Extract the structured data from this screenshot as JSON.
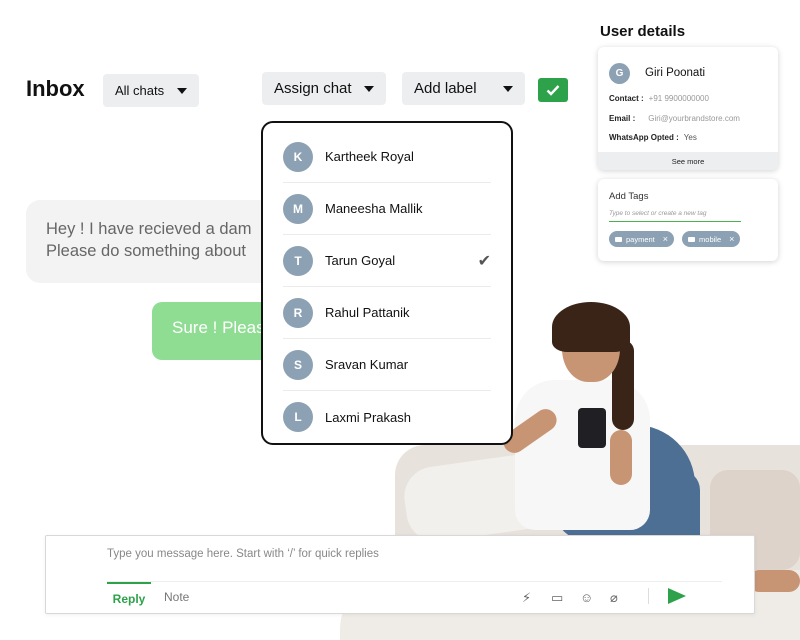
{
  "header": {
    "title": "Inbox",
    "filter_label": "All chats",
    "assign_label": "Assign chat",
    "label_label": "Add label",
    "confirm_icon": "check-icon",
    "accent_color": "#2ea24a"
  },
  "messages": {
    "incoming": [
      "Hey ! I have recieved a dam",
      "Please do something about"
    ],
    "outgoing": "Sure ! Pleas"
  },
  "assign_menu": {
    "agents": [
      {
        "initial": "K",
        "name": "Kartheek Royal",
        "selected": false
      },
      {
        "initial": "M",
        "name": "Maneesha Mallik",
        "selected": false
      },
      {
        "initial": "T",
        "name": "Tarun Goyal",
        "selected": true
      },
      {
        "initial": "R",
        "name": "Rahul Pattanik",
        "selected": false
      },
      {
        "initial": "S",
        "name": "Sravan Kumar",
        "selected": false
      },
      {
        "initial": "L",
        "name": "Laxmi Prakash",
        "selected": false
      }
    ],
    "check_mark": "✔"
  },
  "user_details": {
    "title": "User details",
    "initial": "G",
    "name": "Giri Poonati",
    "contact_label": "Contact :",
    "contact_value": "+91 9900000000",
    "email_label": "Email :",
    "email_value": "Giri@yourbrandstore.com",
    "whatsapp_label": "WhatsApp Opted :",
    "whatsapp_value": "Yes",
    "see_more": "See more"
  },
  "tags": {
    "title": "Add Tags",
    "placeholder": "Type to select or create a new tag",
    "items": [
      {
        "label": "payment",
        "remove": "×"
      },
      {
        "label": "mobile",
        "remove": "×"
      }
    ]
  },
  "composer": {
    "placeholder": "Type you message here. Start with ‘/’ for quick replies",
    "tab_reply": "Reply",
    "tab_note": "Note",
    "tools": [
      "bolt-icon",
      "template-icon",
      "emoji-icon",
      "attach-icon"
    ],
    "tool_glyphs": [
      "⚡",
      "▭",
      "☺",
      "⌀"
    ],
    "send_icon": "send-icon"
  }
}
